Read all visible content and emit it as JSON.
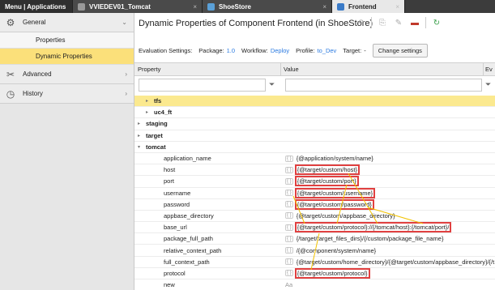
{
  "tabs": [
    {
      "label": "Menu | Applications"
    },
    {
      "label": "VVIEDEV01_Tomcat",
      "close": "×"
    },
    {
      "label": "ShoeStore",
      "close": "×"
    },
    {
      "label": "Frontend",
      "close": "×"
    }
  ],
  "sidebar": {
    "groups": [
      {
        "label": "General",
        "chevron": "⌄"
      },
      {
        "label": "Advanced",
        "chevron": "›"
      },
      {
        "label": "History",
        "chevron": "›"
      }
    ],
    "items": [
      {
        "label": "Properties"
      },
      {
        "label": "Dynamic Properties"
      }
    ]
  },
  "page": {
    "title": "Dynamic Properties of Component Frontend (in ShoeStore)"
  },
  "settings": {
    "eval_label": "Evaluation Settings:",
    "package_label": "Package:",
    "package_value": "1.0",
    "workflow_label": "Workflow:",
    "workflow_value": "Deploy",
    "profile_label": "Profile:",
    "profile_value": "to_Dev",
    "target_label": "Target:",
    "target_value": "-",
    "button": "Change settings"
  },
  "table": {
    "columns": [
      "Property",
      "Value",
      "Ev"
    ],
    "rows": [
      {
        "key": "tfs",
        "value": "",
        "bold": true,
        "indent": 2,
        "arrow": "▸",
        "highlight": true
      },
      {
        "key": "uc4_ft",
        "value": "",
        "bold": true,
        "indent": 2,
        "arrow": "▸"
      },
      {
        "key": "staging",
        "value": "",
        "bold": true,
        "indent": 1,
        "arrow": "▸"
      },
      {
        "key": "target",
        "value": "",
        "bold": true,
        "indent": 1,
        "arrow": "▸"
      },
      {
        "key": "tomcat",
        "value": "",
        "bold": true,
        "indent": 1,
        "arrow": "▾"
      },
      {
        "key": "application_name",
        "value": "{@application/system/name}",
        "indent": 3
      },
      {
        "key": "host",
        "value": "{@target/custom/host}",
        "indent": 3,
        "boxed": true
      },
      {
        "key": "port",
        "value": "{@target/custom/port}",
        "indent": 3,
        "boxed": true
      },
      {
        "key": "username",
        "value": "{@target/custom/username}",
        "indent": 3,
        "boxed": true
      },
      {
        "key": "password",
        "value": "{@target/custom/password}",
        "indent": 3,
        "boxed": true
      },
      {
        "key": "appbase_directory",
        "value": "{@target/custom/appbase_directory}",
        "indent": 3
      },
      {
        "key": "base_url",
        "value": "{@target/custom/protocol}://{/tomcat/host}:{/tomcat/port}/",
        "indent": 3,
        "boxed": true
      },
      {
        "key": "package_full_path",
        "value": "{/target/target_files_dirs}/{/custom/package_file_name}",
        "indent": 3,
        "badge": false
      },
      {
        "key": "relative_context_path",
        "value": "/{@component/system/name}",
        "indent": 3,
        "badge": false
      },
      {
        "key": "full_context_path",
        "value": "{@target/custom/home_directory}/{@target/custom/appbase_directory}/{/t...",
        "indent": 3
      },
      {
        "key": "protocol",
        "value": "{@target/custom/protocol}",
        "indent": 3,
        "boxed": true
      },
      {
        "key": "new",
        "value": "Aa",
        "indent": 3,
        "badge": false,
        "muted": true
      }
    ]
  },
  "icons": {
    "general": "gear-icon",
    "advanced": "tools-icon",
    "history": "clock-icon",
    "filter": "funnel-icon"
  },
  "colors": {
    "highlight": "#fbe07a",
    "link": "#2a7ae0",
    "annotation_box": "#e04040",
    "annotation_line": "#f2c200"
  }
}
